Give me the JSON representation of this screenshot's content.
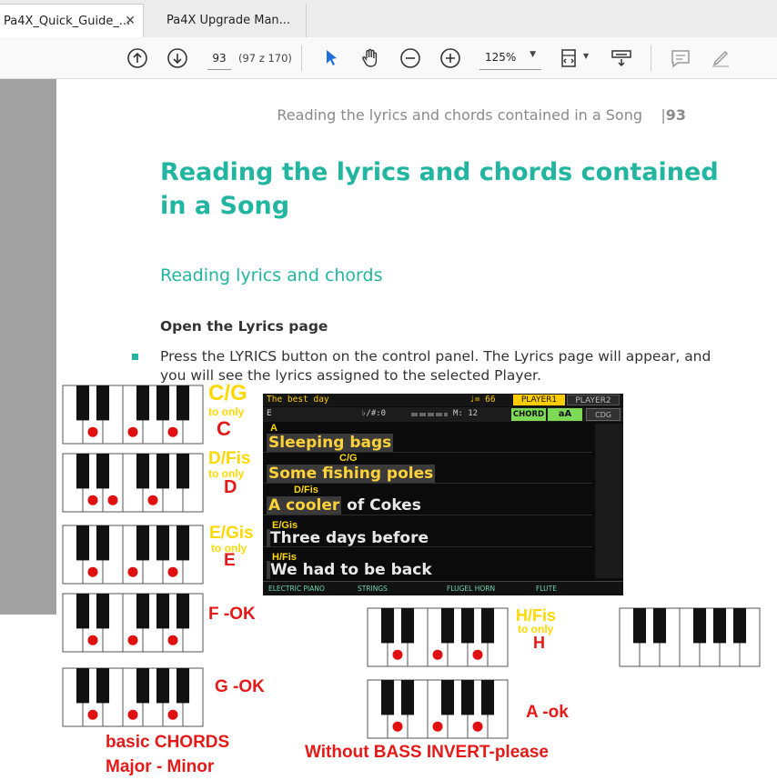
{
  "tabs": [
    {
      "label": "Pa4X_Quick_Guide_...",
      "close": "✕",
      "active": true
    },
    {
      "label": "Pa4X Upgrade Man...",
      "active": false
    }
  ],
  "toolbar": {
    "page_current": "93",
    "page_count": "(97 z 170)",
    "zoom": "125%",
    "icons": [
      "arrow-up-circle",
      "arrow-down-circle",
      "select-pointer",
      "hand",
      "zoom-out",
      "zoom-in",
      "fit-page",
      "read-aloud",
      "comment",
      "highlight"
    ]
  },
  "document": {
    "running_head": "Reading the lyrics and chords contained in a Song",
    "page_num": "93",
    "title": "Reading the lyrics and chords contained in a Song",
    "subtitle": "Reading lyrics and chords",
    "subsub": "Open the Lyrics page",
    "para_pre": "Press the ",
    "para_btn": "LYRICS",
    "para_post": " button on the control panel. The Lyrics page will appear, and you will see the lyrics assigned to the selected Player."
  },
  "screen": {
    "song_title": "The best day",
    "tempo": "♩= 66",
    "player1": "PLAYER1",
    "player2": "PLAYER2",
    "key": "E",
    "transpose": "♭/#:0",
    "measure": "M: 12",
    "chord_btn": "CHORD",
    "aa_btn": "aA",
    "cdg_btn": "CDG",
    "lines": [
      {
        "chord": "A",
        "hl": "Sleeping bags",
        "rest": ""
      },
      {
        "chord": "C/G",
        "hl": "Some fishing poles",
        "rest": ""
      },
      {
        "chord": "D/Fis",
        "hl": "A cooler",
        "rest": " of Cokes"
      },
      {
        "chord": "E/Gis",
        "hl": "",
        "rest": "Three days before"
      },
      {
        "chord": "H/Fis",
        "hl": "",
        "rest": "We had to be back"
      }
    ],
    "instruments": [
      "ELECTRIC PIANO",
      "STRINGS",
      "FLUGEL HORN",
      "FLUTE"
    ]
  },
  "annotations": {
    "cg": {
      "chord": "C/G",
      "small": "to only",
      "big": "C"
    },
    "dfis": {
      "chord": "D/Fis",
      "small": "to only",
      "big": "D"
    },
    "egis": {
      "chord": "E/Gis",
      "small": "to only",
      "big": "E"
    },
    "f_ok": "F -OK",
    "g_ok": "G -OK",
    "hfis": {
      "chord": "H/Fis",
      "small": "to only",
      "big": "H"
    },
    "a_ok": "A  -ok",
    "basic1": "basic CHORDS",
    "basic2": "Major - Minor",
    "without": "Without BASS INVERT-please"
  },
  "colors": {
    "heading": "#22b5a0",
    "yellow": "#ffd800",
    "red": "#e61919",
    "marker": "#e01010"
  },
  "keyboards": [
    {
      "id": "kb-cg",
      "dots": [
        1,
        3,
        5
      ]
    },
    {
      "id": "kb-dfis",
      "dots": [
        1,
        2,
        4
      ]
    },
    {
      "id": "kb-egis",
      "dots": [
        1,
        3,
        5
      ]
    },
    {
      "id": "kb-f",
      "dots": [
        1,
        3,
        5
      ]
    },
    {
      "id": "kb-g",
      "dots": [
        1,
        3,
        5
      ]
    },
    {
      "id": "kb-hfis",
      "dots": [
        1,
        3,
        5
      ]
    },
    {
      "id": "kb-a",
      "dots": [
        1,
        3,
        5
      ]
    },
    {
      "id": "kb-blank",
      "dots": []
    }
  ]
}
